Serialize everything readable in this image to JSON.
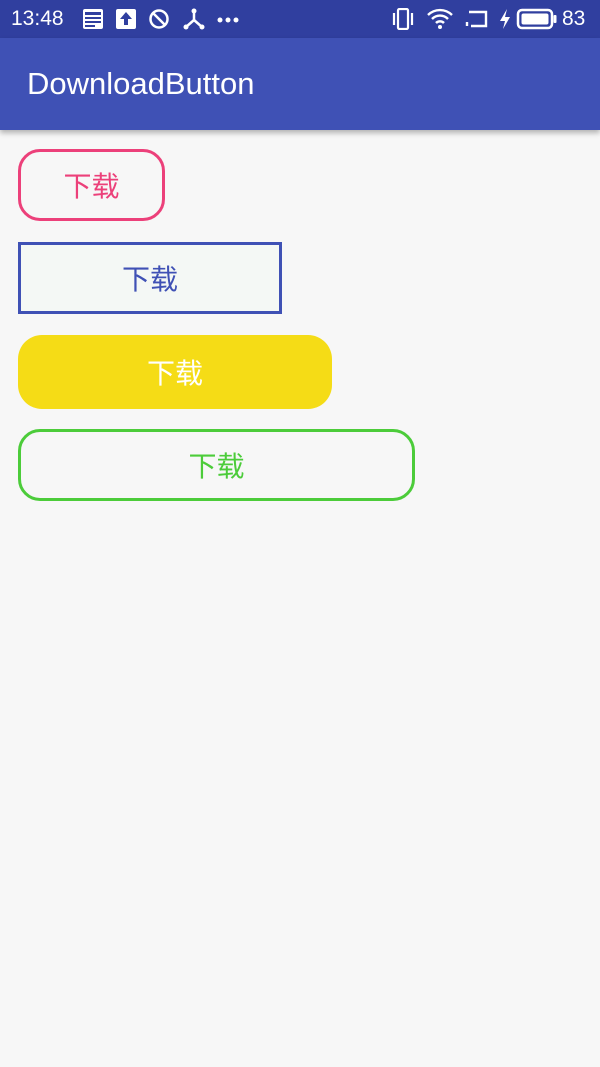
{
  "status_bar": {
    "time": "13:48",
    "battery_percent": "83",
    "icons": [
      "news-icon",
      "upload-icon",
      "do-not-disturb-icon",
      "usb-icon",
      "more-dots-icon",
      "vibrate-icon",
      "wifi-icon",
      "screen-cast-icon",
      "charging-icon",
      "battery-icon"
    ],
    "background_color": "#303f9f"
  },
  "app_bar": {
    "title": "DownloadButton",
    "background_color": "#3f51b5"
  },
  "buttons": [
    {
      "label": "下载",
      "color": "#ec407a",
      "style": "rounded-outline"
    },
    {
      "label": "下载",
      "color": "#3f51b5",
      "style": "square-outline"
    },
    {
      "label": "下载",
      "color": "#f5dc16",
      "style": "rounded-filled"
    },
    {
      "label": "下载",
      "color": "#4ccc3a",
      "style": "rounded-outline"
    }
  ]
}
